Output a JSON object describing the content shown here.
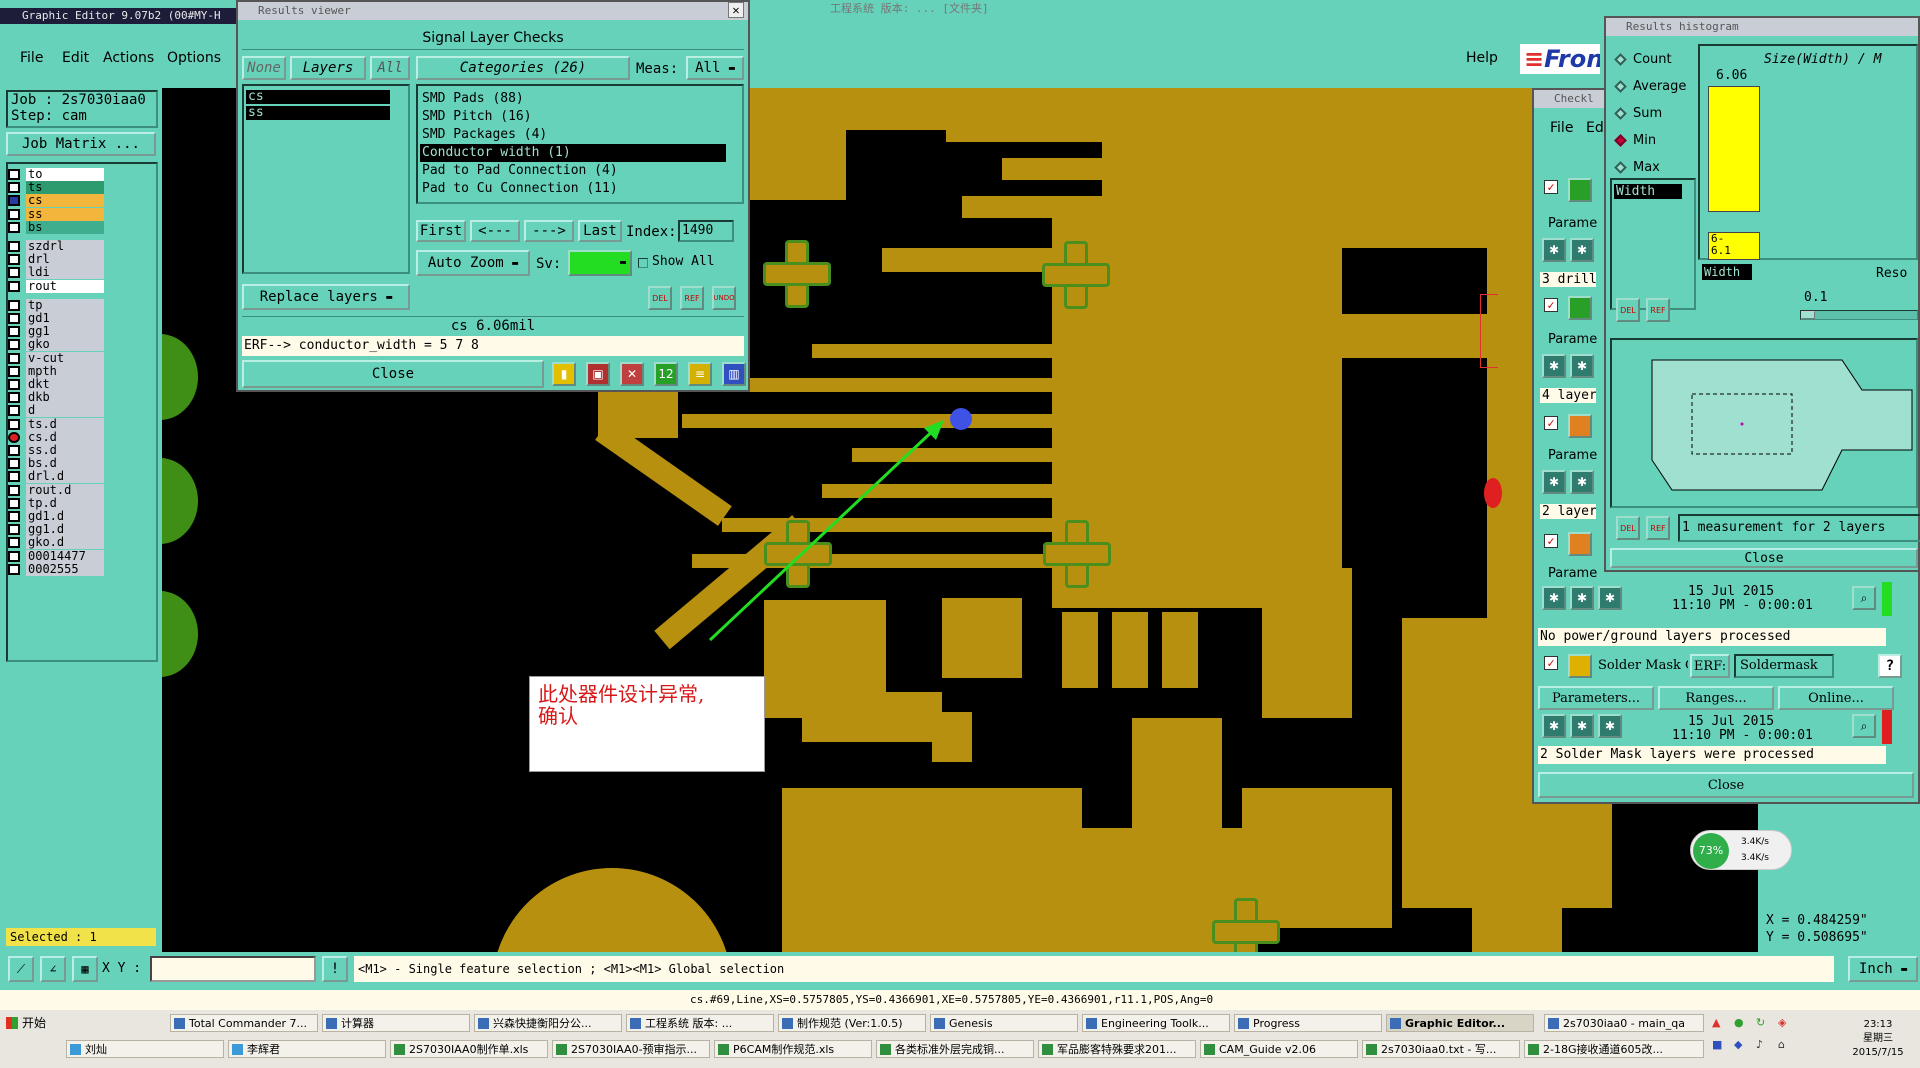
{
  "graphic_editor": {
    "title": "Graphic Editor 9.07b2 (00#MY-H",
    "menu": [
      "File",
      "Edit",
      "Actions",
      "Options",
      "Help"
    ],
    "job_label": "Job : 2s7030iaa0",
    "step_label": "Step: cam",
    "job_matrix": "Job Matrix ...",
    "logo_text": "Fron",
    "selected": "Selected : 1",
    "xy_label": "X Y :",
    "xy_value": "",
    "hint": "<M1> - Single feature selection ; <M1><M1> Global selection",
    "units": "Inch",
    "coord_x": "X = 0.484259\"",
    "coord_y": "Y = 0.508695\"",
    "status_line": "cs.#69,Line,XS=0.5757805,YS=0.4366901,XE=0.5757805,YE=0.4366901,r11.1,POS,Ang=0",
    "top_faint": "工程系统 版本: ...  [文件夹]",
    "layers": [
      {
        "name": "to",
        "style": "white"
      },
      {
        "name": "ts",
        "style": "green"
      },
      {
        "name": "cs",
        "style": "orange"
      },
      {
        "name": "ss",
        "style": "orange"
      },
      {
        "name": "bs",
        "style": "teal2"
      },
      {
        "name": "szdrl",
        "style": "gray"
      },
      {
        "name": "drl",
        "style": "gray"
      },
      {
        "name": "ldi",
        "style": "gray"
      },
      {
        "name": "rout",
        "style": "white"
      },
      {
        "name": "tp",
        "style": "gray"
      },
      {
        "name": "gd1",
        "style": "gray"
      },
      {
        "name": "gg1",
        "style": "gray"
      },
      {
        "name": "gko",
        "style": "gray"
      },
      {
        "name": "v-cut",
        "style": "gray"
      },
      {
        "name": "mpth",
        "style": "gray"
      },
      {
        "name": "dkt",
        "style": "gray"
      },
      {
        "name": "dkb",
        "style": "gray"
      },
      {
        "name": "d",
        "style": "gray"
      },
      {
        "name": "ts.d",
        "style": "gray"
      },
      {
        "name": "cs.d",
        "style": "gray"
      },
      {
        "name": "ss.d",
        "style": "gray"
      },
      {
        "name": "bs.d",
        "style": "gray"
      },
      {
        "name": "drl.d",
        "style": "gray"
      },
      {
        "name": "rout.d",
        "style": "gray"
      },
      {
        "name": "tp.d",
        "style": "gray"
      },
      {
        "name": "gd1.d",
        "style": "gray"
      },
      {
        "name": "gg1.d",
        "style": "gray"
      },
      {
        "name": "gko.d",
        "style": "gray"
      },
      {
        "name": "00014477",
        "style": "gray"
      },
      {
        "name": "0002555",
        "style": "gray"
      }
    ]
  },
  "results_viewer": {
    "title": "Results viewer",
    "header": "Signal Layer Checks",
    "none_btn": "None",
    "layers_btn": "Layers",
    "all_btn": "All",
    "layer_list": [
      "cs",
      "ss"
    ],
    "categories_btn": "Categories (26)",
    "meas_label": "Meas:",
    "meas_value": "All",
    "categories": [
      "SMD Pads (88)",
      "SMD Pitch (16)",
      "SMD Packages (4)",
      "Conductor width (1)",
      "Pad to Pad Connection (4)",
      "Pad to Cu Connection (11)"
    ],
    "selected_category": 3,
    "nav": {
      "first": "First",
      "prev": "<---",
      "next": "--->",
      "last": "Last",
      "index_label": "Index:",
      "index_value": "1490"
    },
    "auto_zoom": "Auto Zoom",
    "sv_label": "Sv:",
    "show_all": "Show All",
    "replace_layers": "Replace layers",
    "small_btns": [
      "DEL",
      "REF",
      "UNDO"
    ],
    "measure_line": "cs 6.06mil",
    "erf_line": "ERF--> conductor_width = 5 7 8",
    "close": "Close"
  },
  "annotation": {
    "text_line1": "此处器件设计异常,",
    "text_line2": "确认"
  },
  "histogram": {
    "title": "Results histogram",
    "options": [
      "Count",
      "Average",
      "Sum",
      "Min",
      "Max"
    ],
    "selected_option": "Min",
    "size_label": "Size(Width) / M",
    "list_item": "Width",
    "bar_value": "6.06",
    "range_label": "6-\n6.1",
    "width_label": "Width",
    "reso_label": "Reso",
    "reso_value": "0.1",
    "measurement_text": "1 measurement for 2 layers",
    "close": "Close",
    "small_btns": [
      "DEL",
      "REF"
    ]
  },
  "checklist": {
    "title": "Checkl",
    "menu": [
      "File",
      "Ed"
    ],
    "param_label": "Parame",
    "rows": [
      "3 drill",
      "4 layer",
      "2 layer"
    ],
    "date1": "15 Jul 2015",
    "time1": "11:10 PM - 0:00:01",
    "no_power": "No power/ground layers processed",
    "solder_mask": "Solder Mask Ch",
    "erf_label": "ERF:",
    "erf_value": "Soldermask",
    "help": "?",
    "parameters_btn": "Parameters...",
    "ranges_btn": "Ranges...",
    "online_btn": "Online...",
    "date2": "15 Jul 2015",
    "time2": "11:10 PM - 0:00:01",
    "solder_processed": "2 Solder Mask layers were processed",
    "close": "Close"
  },
  "net_widget": {
    "percent": "73%",
    "up": "3.4K/s",
    "down": "3.4K/s"
  },
  "taskbar": {
    "start": "开始",
    "row1": [
      "Total Commander 7...",
      "计算器",
      "兴森快捷衡阳分公...",
      "工程系统  版本: ...",
      "制作规范 (Ver:1.0.5)",
      "Genesis",
      "Engineering Toolk...",
      "Progress",
      "Graphic Editor...",
      "2s7030iaa0 - main_qa"
    ],
    "row2": [
      "刘灿",
      "李辉君",
      "2S7030IAA0制作单.xls",
      "2S7030IAA0-预审指示...",
      "P6CAM制作规范.xls",
      "各类标准外层完成铜...",
      "军品膨客特殊要求201...",
      "CAM_Guide v2.06",
      "2s7030iaa0.txt - 写...",
      "2-18G接收通道605改..."
    ],
    "time": "23:13",
    "weekday": "星期三",
    "date": "2015/7/15"
  }
}
